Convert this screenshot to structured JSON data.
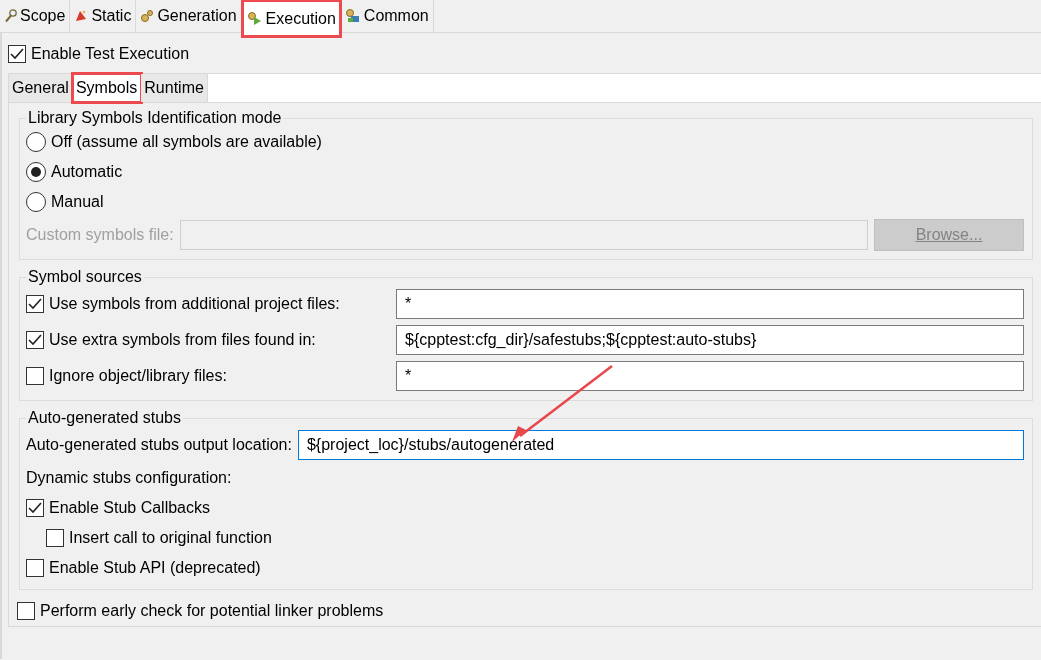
{
  "outer_tabs": [
    {
      "label": "Scope",
      "kind": "magnifier",
      "selected": false,
      "highlighted": false
    },
    {
      "label": "Static",
      "kind": "hat",
      "selected": false,
      "highlighted": false
    },
    {
      "label": "Generation",
      "kind": "gear",
      "selected": false,
      "highlighted": false
    },
    {
      "label": "Execution",
      "kind": "gear-play",
      "selected": true,
      "highlighted": true
    },
    {
      "label": "Common",
      "kind": "gear-blocks",
      "selected": false,
      "highlighted": false
    }
  ],
  "enable_test_execution": {
    "label": "Enable Test Execution",
    "checked": true
  },
  "inner_tabs": [
    {
      "label": "General",
      "selected": false,
      "highlighted": false
    },
    {
      "label": "Symbols",
      "selected": true,
      "highlighted": true
    },
    {
      "label": "Runtime",
      "selected": false,
      "highlighted": false
    }
  ],
  "library_group": {
    "title": "Library Symbols Identification mode",
    "options": [
      {
        "label": "Off (assume all symbols are available)",
        "selected": false
      },
      {
        "label": "Automatic",
        "selected": true
      },
      {
        "label": "Manual",
        "selected": false
      }
    ],
    "custom_file": {
      "label": "Custom symbols file:",
      "disabled": true
    },
    "browse_button": {
      "label": "Browse...",
      "disabled": true
    }
  },
  "symbol_sources": {
    "title": "Symbol sources",
    "rows": [
      {
        "label": "Use symbols from additional project files:",
        "checked": true,
        "value": "*"
      },
      {
        "label": "Use extra symbols from files found in:",
        "checked": true,
        "value": "${cpptest:cfg_dir}/safestubs;${cpptest:auto-stubs}"
      },
      {
        "label": "Ignore object/library files:",
        "checked": false,
        "value": "*"
      }
    ]
  },
  "stubs": {
    "title": "Auto-generated stubs",
    "output_location": {
      "label": "Auto-generated stubs output location:",
      "value": "${project_loc}/stubs/autogenerated",
      "focused": true
    },
    "dynamic_label": "Dynamic stubs configuration:",
    "options": [
      {
        "label": "Enable Stub Callbacks",
        "checked": true,
        "children": [
          {
            "label": "Insert call to original function",
            "checked": false
          }
        ]
      },
      {
        "label": "Enable Stub API (deprecated)",
        "checked": false
      }
    ]
  },
  "early_check": {
    "label": "Perform early check for potential linker problems",
    "checked": false
  }
}
